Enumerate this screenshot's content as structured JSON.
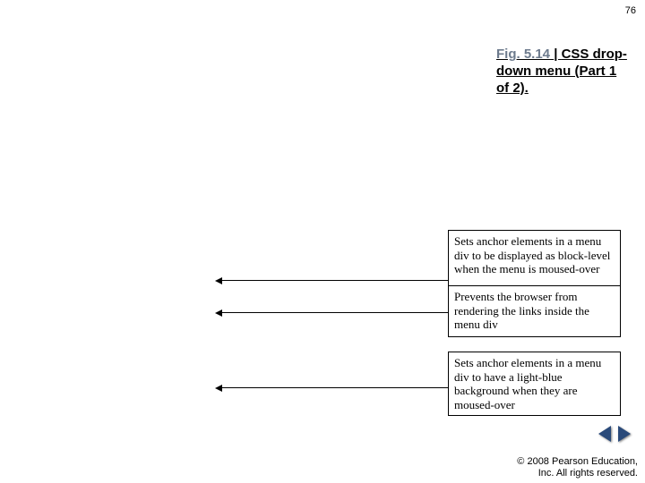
{
  "page_number": "76",
  "caption": {
    "fig_label": "Fig. 5.14",
    "sep": "| ",
    "title": "CSS drop-down menu (Part 1 of 2)."
  },
  "annotations": {
    "a1": "Sets anchor elements in a menu div to be displayed as block-level when the menu is moused-over",
    "a2": "Prevents the browser from rendering the links inside the menu div",
    "a3": "Sets anchor elements in a menu div to have a light-blue background when they are moused-over"
  },
  "nav": {
    "prev_name": "prev",
    "next_name": "next"
  },
  "copyright": {
    "line1": "© 2008 Pearson Education,",
    "line2": "Inc.  All rights reserved."
  }
}
